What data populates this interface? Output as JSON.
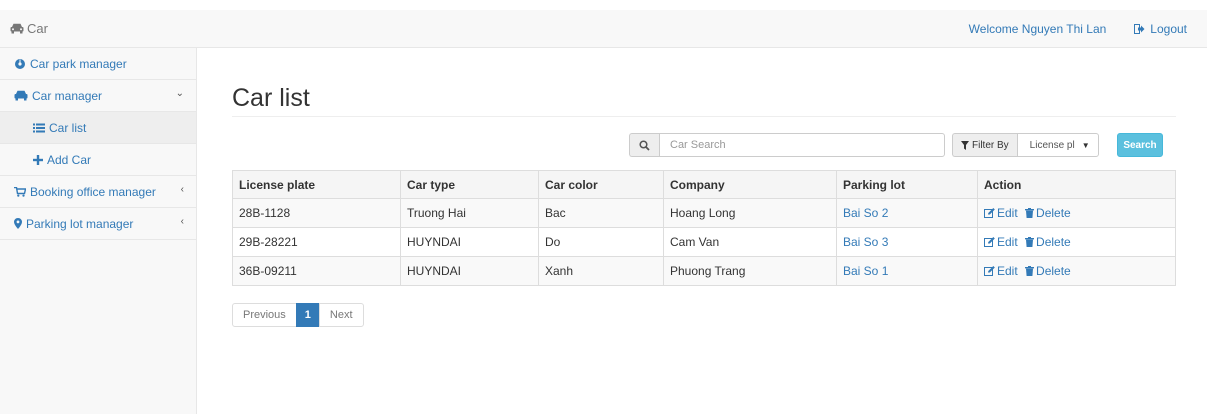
{
  "header": {
    "brand": "Car",
    "welcome": "Welcome Nguyen Thi Lan",
    "logout": "Logout"
  },
  "sidebar": {
    "items": [
      {
        "label": "Car park manager"
      },
      {
        "label": "Car manager"
      },
      {
        "label": "Car list"
      },
      {
        "label": "Add Car"
      },
      {
        "label": "Booking office manager"
      },
      {
        "label": "Parking lot manager"
      }
    ]
  },
  "main": {
    "title": "Car list",
    "search": {
      "placeholder": "Car Search",
      "value": ""
    },
    "filter": {
      "label": "Filter By",
      "selected": "License pl"
    },
    "search_button": "Search",
    "table": {
      "headers": [
        "License plate",
        "Car type",
        "Car color",
        "Company",
        "Parking lot",
        "Action"
      ],
      "rows": [
        {
          "plate": "28B-1128",
          "type": "Truong Hai",
          "color": "Bac",
          "company": "Hoang Long",
          "lot": "Bai So 2"
        },
        {
          "plate": "29B-28221",
          "type": "HUYNDAI",
          "color": "Do",
          "company": "Cam Van",
          "lot": "Bai So 3"
        },
        {
          "plate": "36B-09211",
          "type": "HUYNDAI",
          "color": "Xanh",
          "company": "Phuong Trang",
          "lot": "Bai So 1"
        }
      ],
      "edit_label": "Edit",
      "delete_label": "Delete"
    },
    "pagination": {
      "previous": "Previous",
      "current": "1",
      "next": "Next"
    }
  },
  "colors": {
    "link": "#337ab7",
    "search_button": "#5bc0de",
    "active_page": "#337ab7"
  }
}
